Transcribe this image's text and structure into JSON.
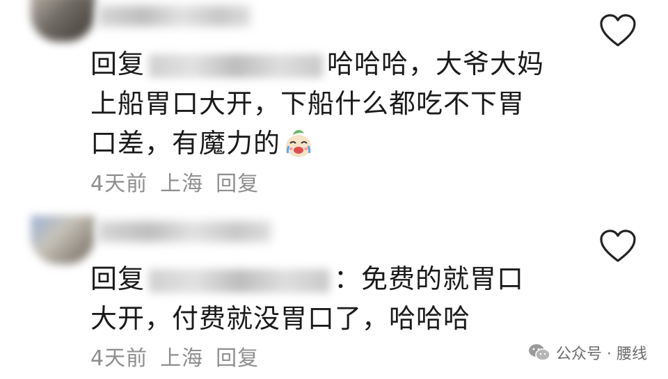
{
  "comments": [
    {
      "reply_prefix": "回复",
      "text": "哈哈哈，大爷大妈上船胃口大开，下船什么都吃不下胃口差，有魔力的",
      "emoji": "crying-laughing-emoji",
      "time": "4天前",
      "location": "上海",
      "reply_label": "回复"
    },
    {
      "reply_prefix": "回复",
      "text": "：免费的就胃口大开，付费就没胃口了，哈哈哈",
      "time": "4天前",
      "location": "上海",
      "reply_label": "回复"
    }
  ],
  "watermark": {
    "text": "公众号 · 腰线",
    "icon": "wechat-icon"
  },
  "colors": {
    "text": "#1a1a1a",
    "meta": "#8e8e8e",
    "heart": "#222222"
  }
}
